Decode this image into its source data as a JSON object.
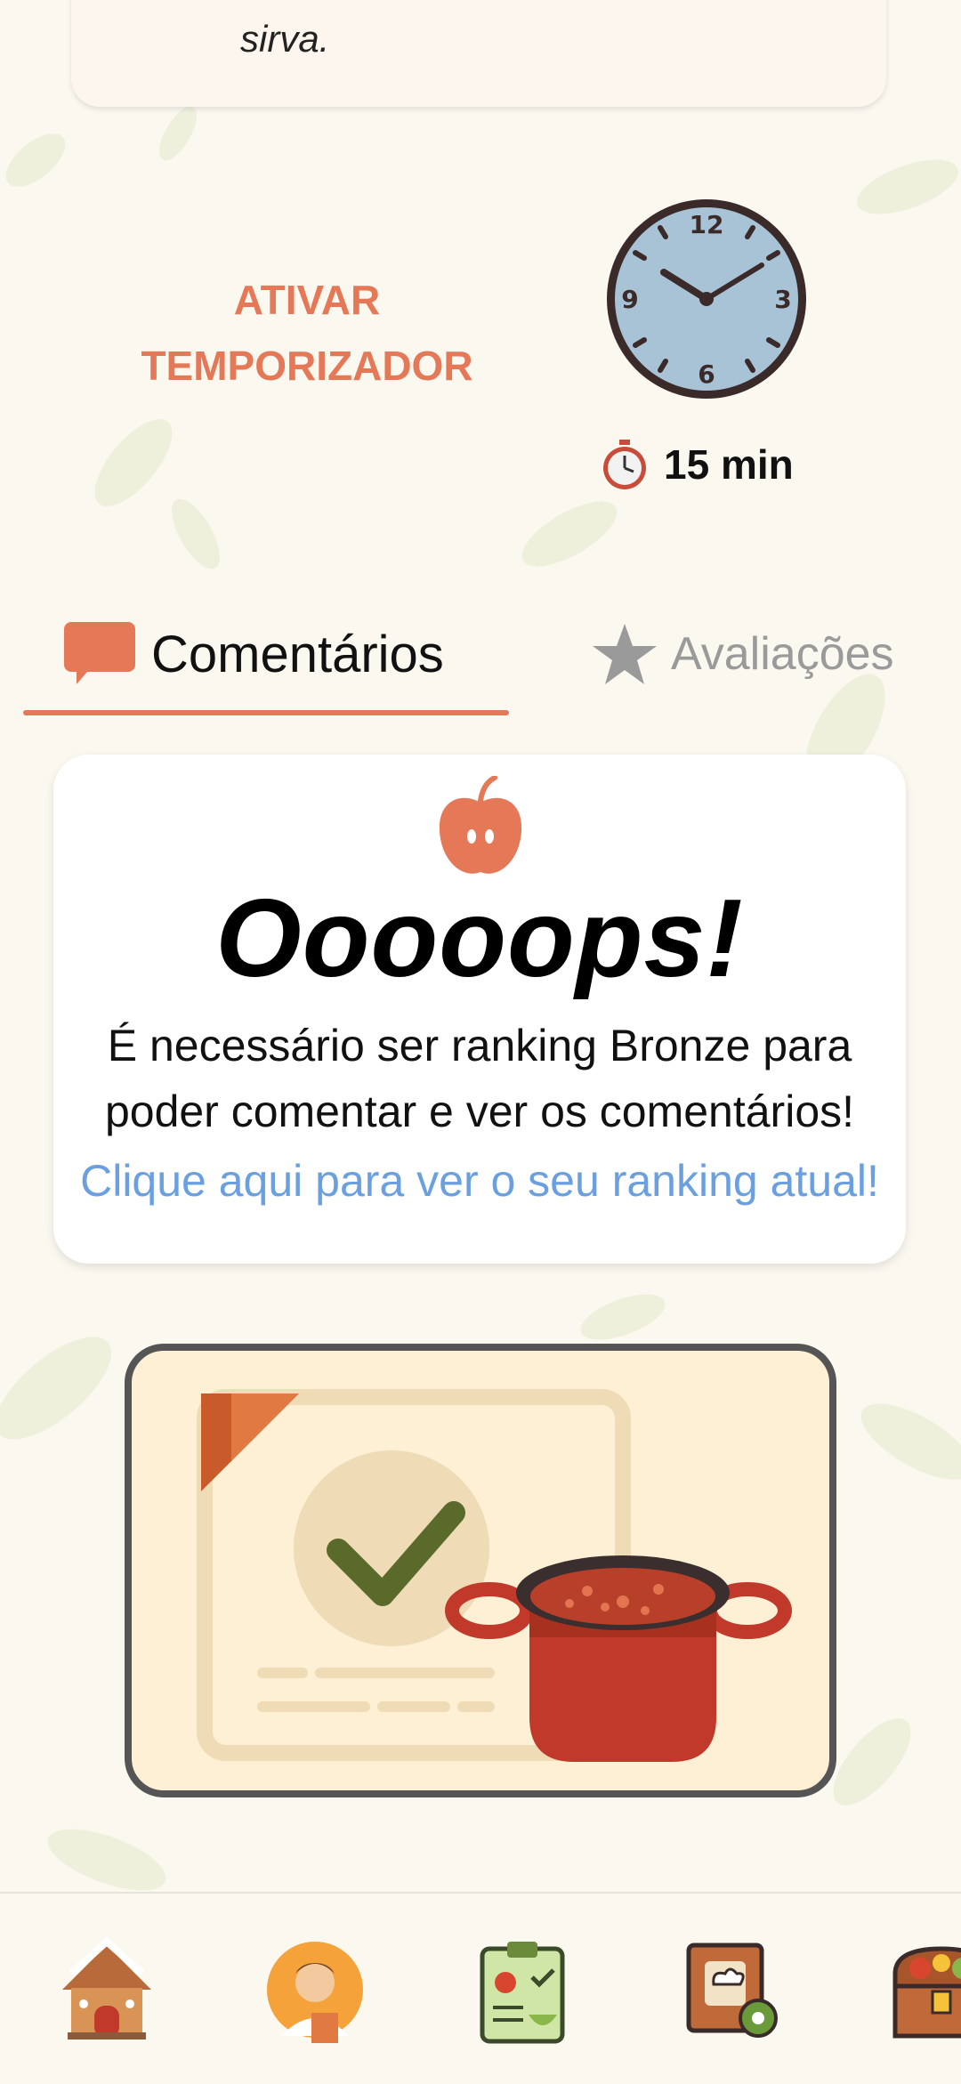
{
  "recipe": {
    "step_tail": "sirva."
  },
  "timer": {
    "button_line1": "ATIVAR",
    "button_line2": "TEMPORIZADOR",
    "duration": "15 min",
    "icon": "stopwatch-icon"
  },
  "tabs": {
    "comments": {
      "label": "Comentários",
      "icon": "speech-bubble-icon",
      "active": true
    },
    "reviews": {
      "label": "Avaliações",
      "icon": "star-icon",
      "active": false
    }
  },
  "restriction": {
    "title": "Ooooops!",
    "message_line1": "É necessário ser ranking Bronze para",
    "message_line2": "poder comentar e ver os comentários!",
    "link": "Clique aqui para ver o seu ranking atual!"
  },
  "nav": {
    "items": [
      {
        "icon": "gingerbread-house-icon"
      },
      {
        "icon": "chef-profile-icon"
      },
      {
        "icon": "checklist-icon"
      },
      {
        "icon": "recipe-book-settings-icon"
      },
      {
        "icon": "treasure-chest-icon"
      }
    ]
  },
  "colors": {
    "accent": "#e47857",
    "link": "#6a9fe0",
    "background": "#faf8ef"
  }
}
